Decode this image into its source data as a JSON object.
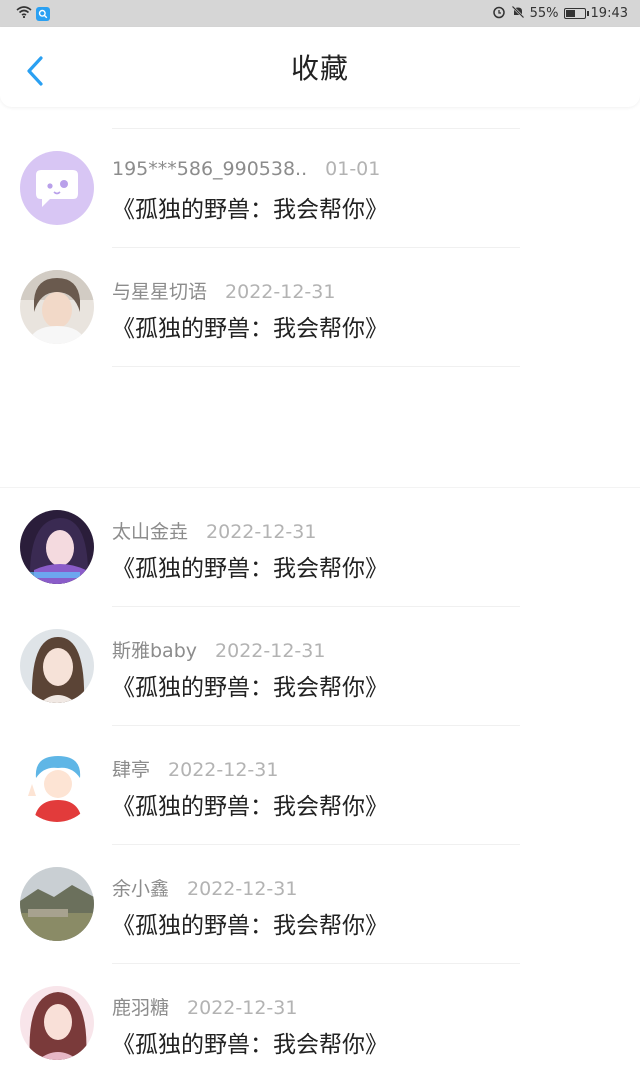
{
  "status_bar": {
    "battery": "55%",
    "battery_level": 0.55,
    "time": "19:43"
  },
  "header": {
    "title": "收藏",
    "back_icon": "chevron-left-icon",
    "accent": "#2aa0f2"
  },
  "items": [
    {
      "user": "195***586_990538..",
      "date": "01-01",
      "content": "《孤独的野兽：我会帮你》",
      "avatar": "chat-bubble-icon"
    },
    {
      "user": "与星星切语",
      "date": "2022-12-31",
      "content": "《孤独的野兽：我会帮你》",
      "avatar": "photo"
    },
    {
      "user": "太山金垚",
      "date": "2022-12-31",
      "content": "《孤独的野兽：我会帮你》",
      "avatar": "photo"
    },
    {
      "user": "斯雅baby",
      "date": "2022-12-31",
      "content": "《孤独的野兽：我会帮你》",
      "avatar": "photo"
    },
    {
      "user": "肆亭",
      "date": "2022-12-31",
      "content": "《孤独的野兽：我会帮你》",
      "avatar": "cartoon"
    },
    {
      "user": "余小鑫",
      "date": "2022-12-31",
      "content": "《孤独的野兽：我会帮你》",
      "avatar": "landscape"
    },
    {
      "user": "鹿羽糖",
      "date": "2022-12-31",
      "content": "《孤独的野兽：我会帮你》",
      "avatar": "photo"
    }
  ]
}
